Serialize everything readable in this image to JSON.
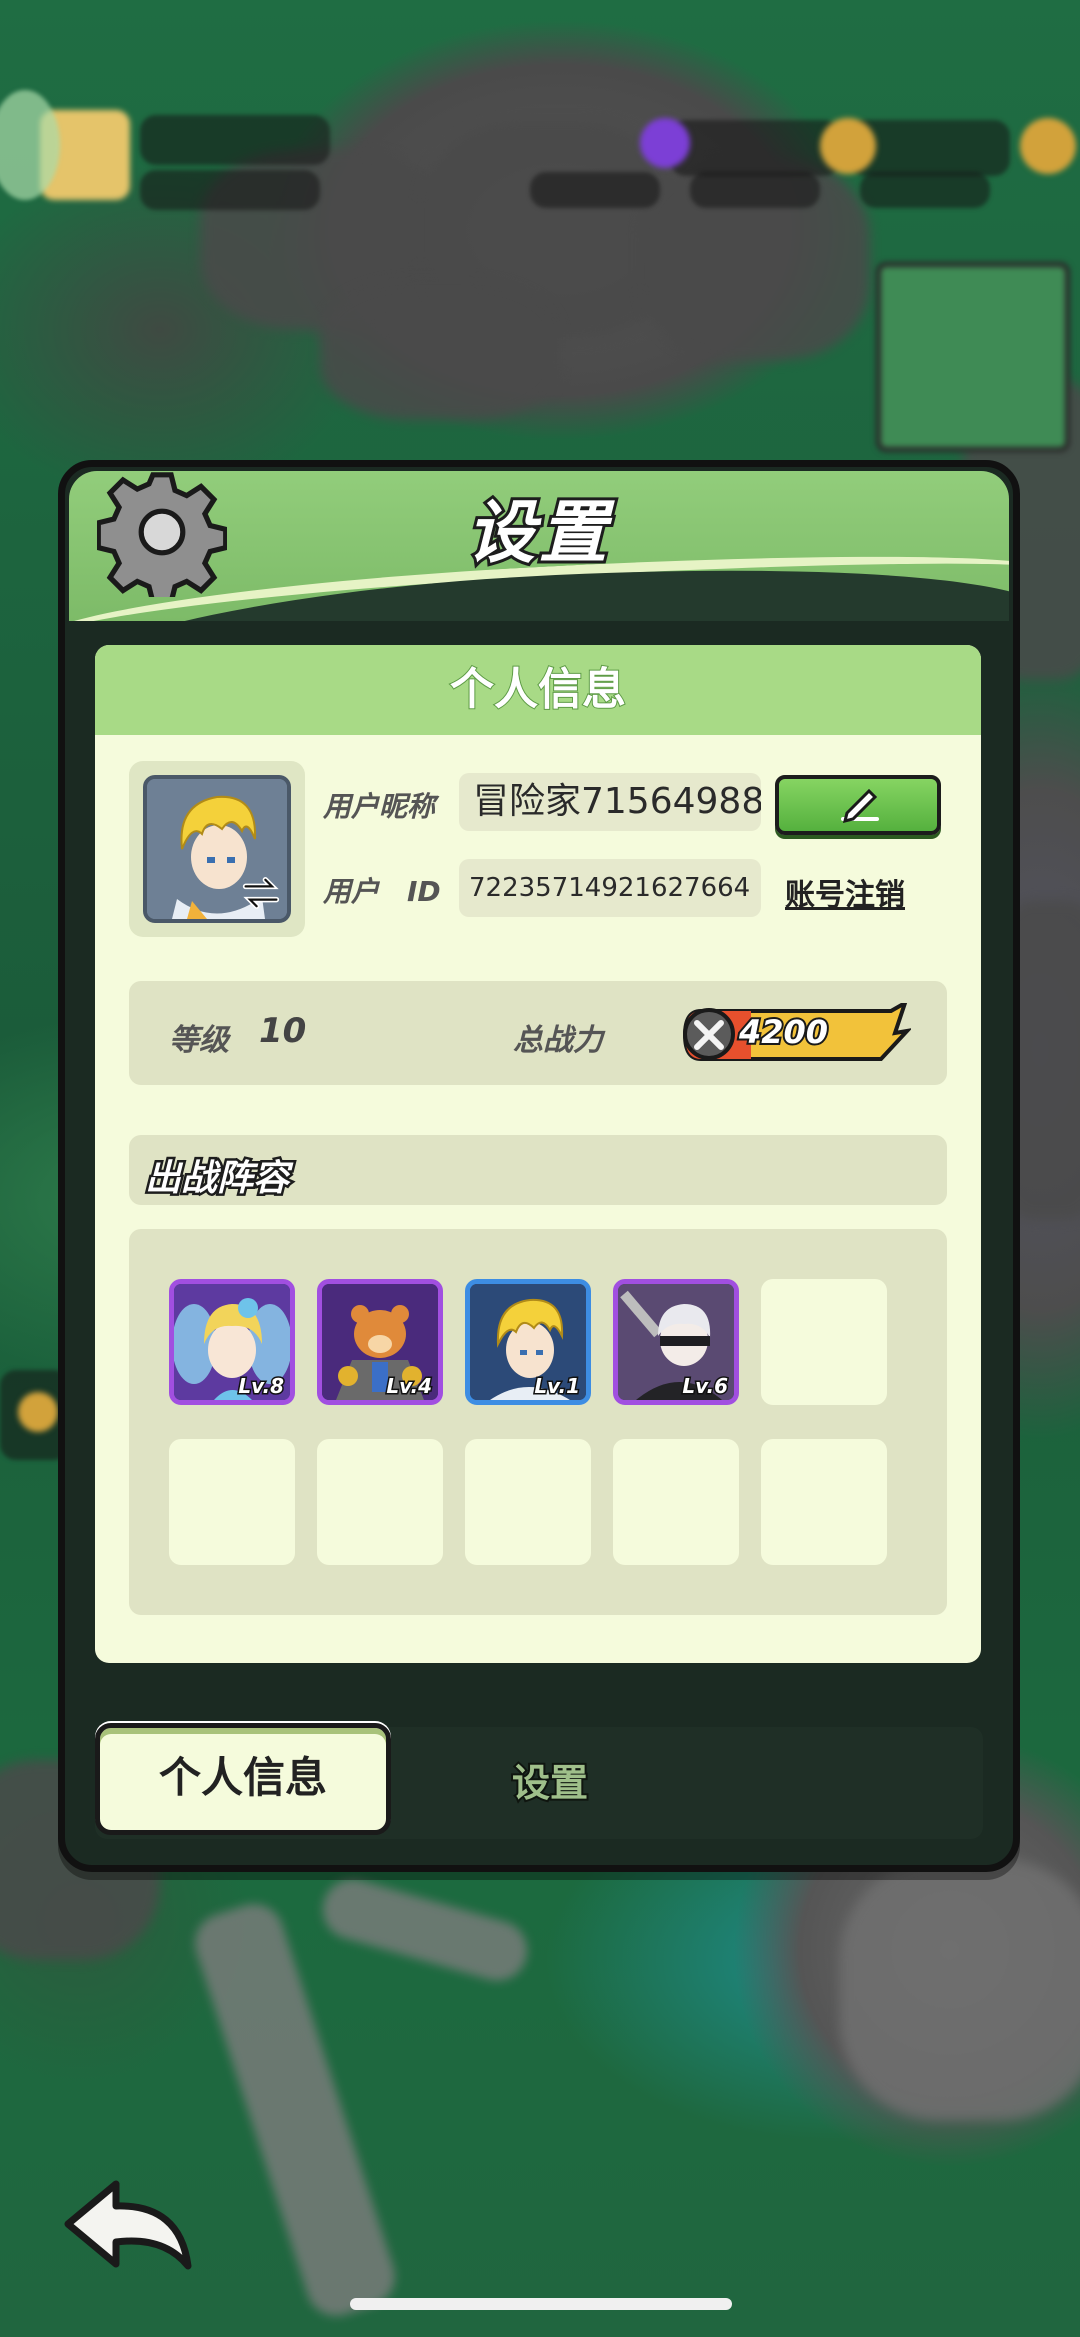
{
  "dialog": {
    "title": "设置",
    "section_header": "个人信息"
  },
  "profile": {
    "nickname_label": "用户昵称",
    "nickname": "冒险家71564988",
    "id_label": "用户　ID",
    "user_id": "72235714921627664",
    "cancel_account_label": "账号注销",
    "edit_icon": "pencil-icon"
  },
  "stats": {
    "level_label": "等级",
    "level": "10",
    "power_label": "总战力",
    "power": "4200"
  },
  "team": {
    "title": "出战阵容",
    "heroes": [
      {
        "level": "Lv.8",
        "rarity_color": "#a14fe0"
      },
      {
        "level": "Lv.4",
        "rarity_color": "#a14fe0"
      },
      {
        "level": "Lv.1",
        "rarity_color": "#3d8de3"
      },
      {
        "level": "Lv.6",
        "rarity_color": "#a14fe0"
      }
    ],
    "empty_slots": 6
  },
  "tabs": {
    "active": "个人信息",
    "inactive": "设置"
  },
  "colors": {
    "header_green": "#92cd7b",
    "panel_bg": "#f5fbdc",
    "button_green": "#55b13e",
    "power_gold": "#f2c23a"
  }
}
